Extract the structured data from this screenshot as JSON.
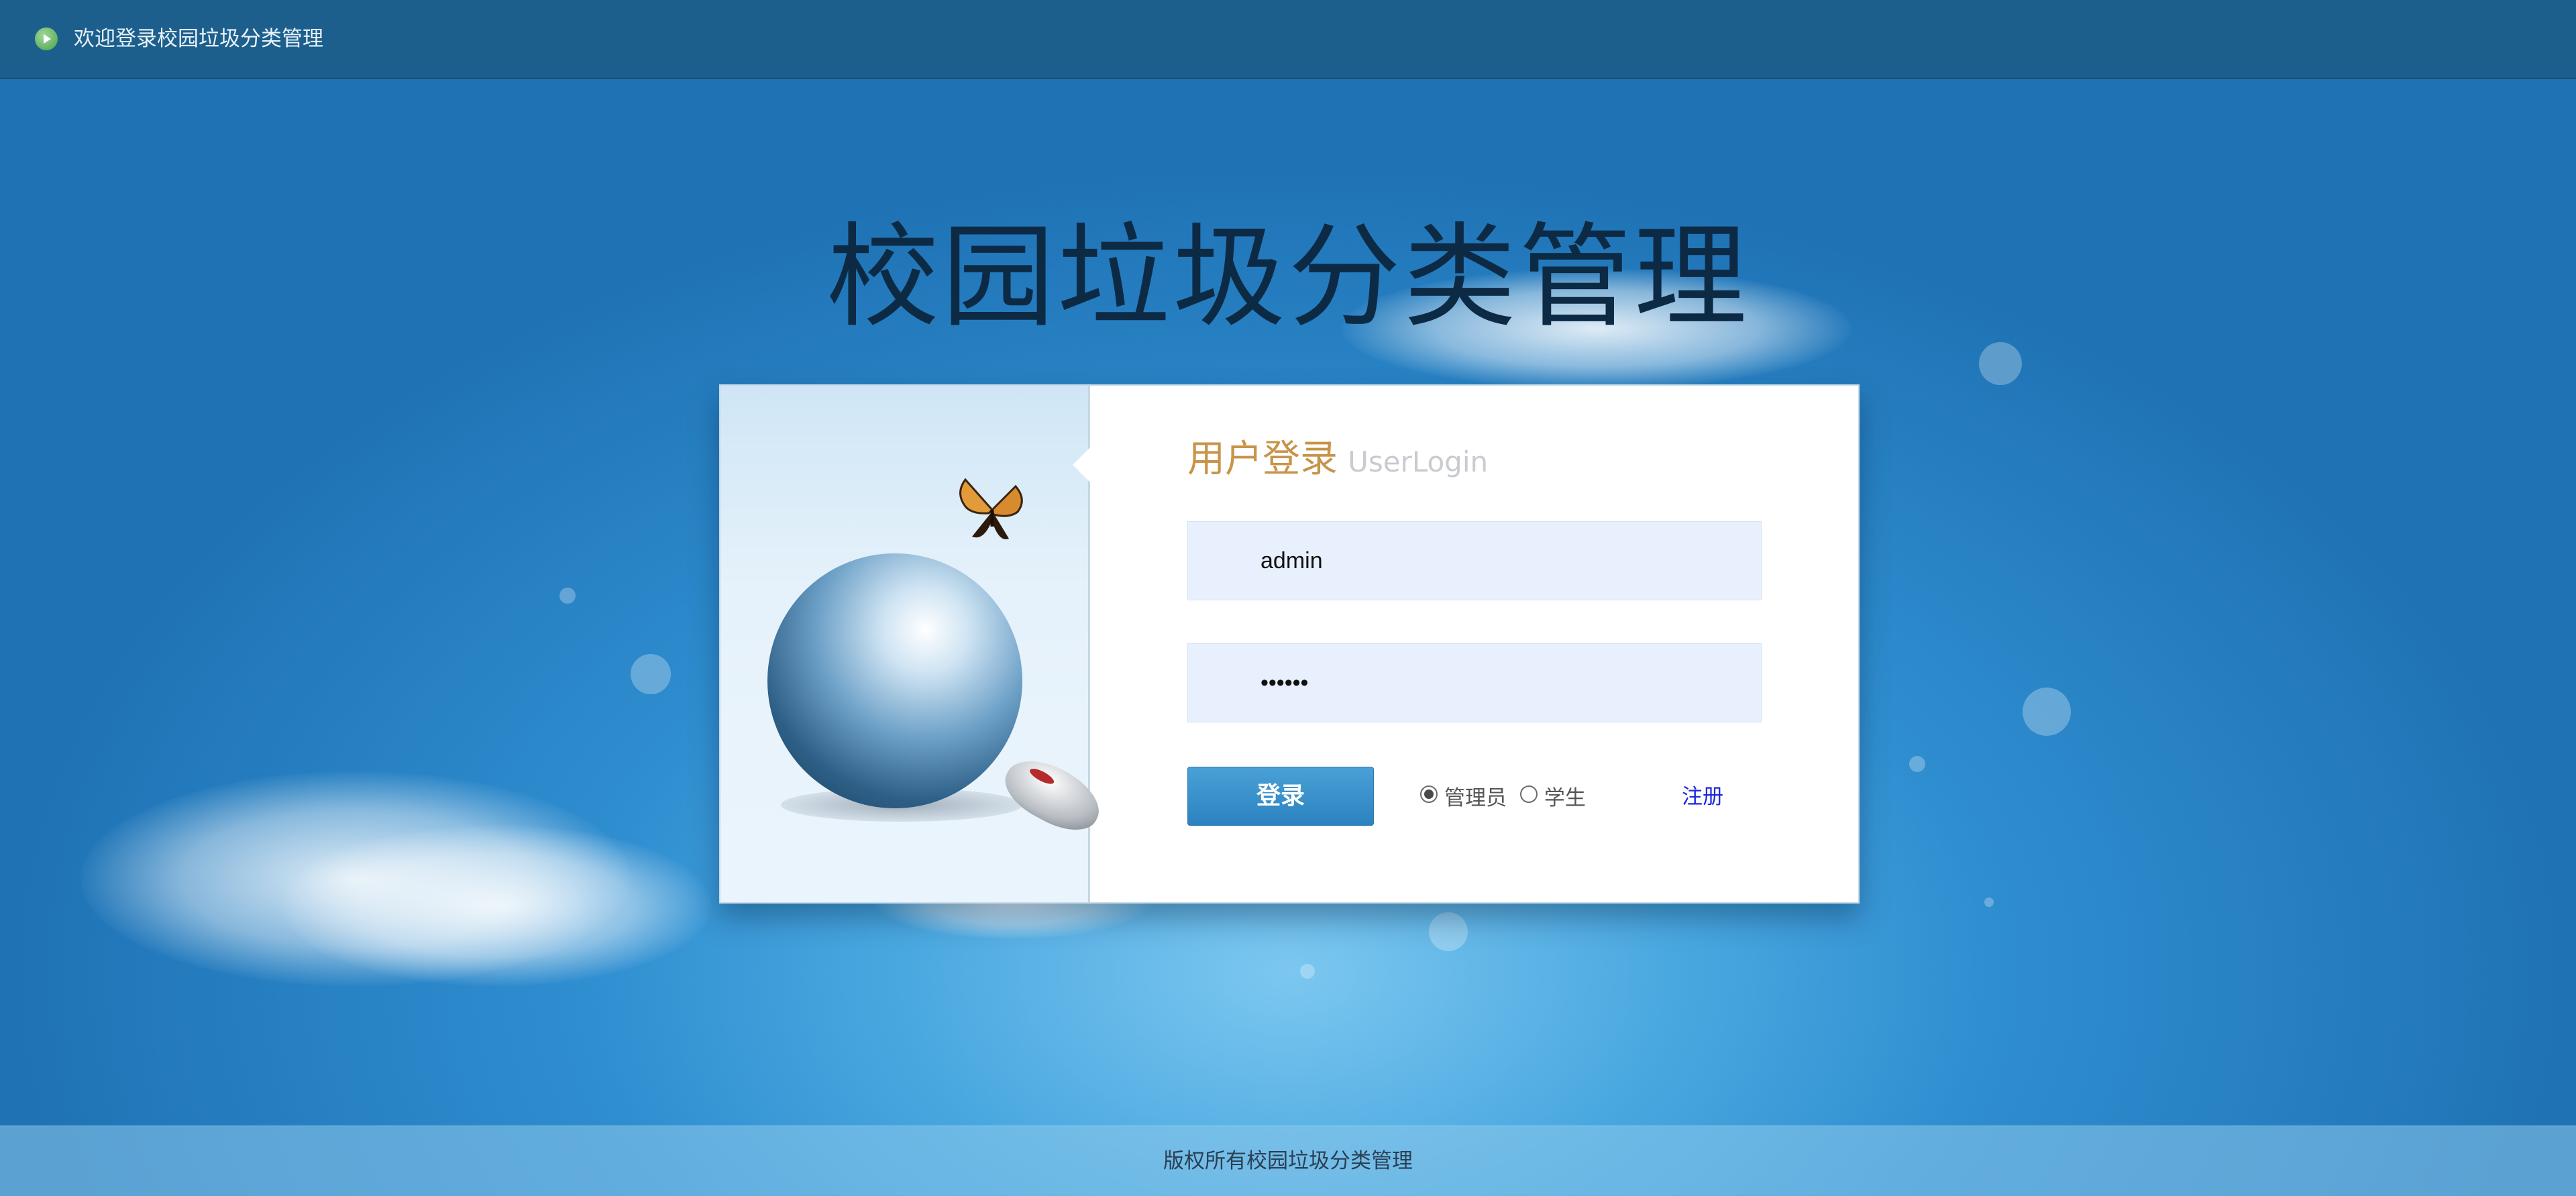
{
  "header": {
    "welcome_text": "欢迎登录校园垃圾分类管理",
    "icon": "play-circle-icon"
  },
  "main": {
    "title": "校园垃圾分类管理"
  },
  "login": {
    "heading_cn": "用户登录",
    "heading_en": "UserLogin",
    "username_value": "admin",
    "password_value": "••••••",
    "login_button_label": "登录",
    "roles": [
      {
        "label": "管理员",
        "checked": true
      },
      {
        "label": "学生",
        "checked": false
      }
    ],
    "register_label": "注册"
  },
  "footer": {
    "copyright": "版权所有校园垃圾分类管理"
  },
  "colors": {
    "topbar": "#1d5f8c",
    "heading_accent": "#c8944a",
    "button": "#3592cd",
    "link": "#1a28e0",
    "input_bg": "#e8f0fe"
  }
}
